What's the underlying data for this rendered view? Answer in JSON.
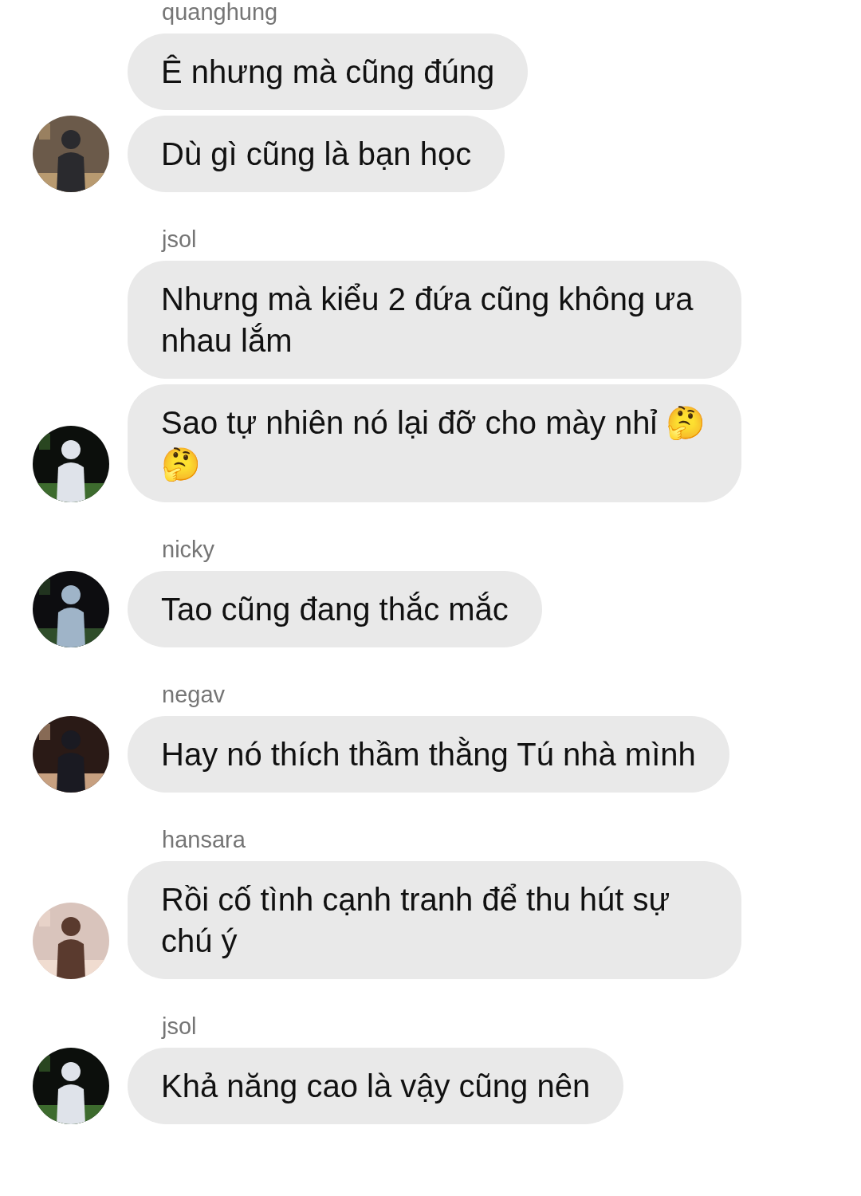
{
  "groups": [
    {
      "sender": "quanghung",
      "avatar": {
        "kind": "picture"
      },
      "messages": [
        "Ê nhưng mà cũng đúng",
        "Dù gì cũng là bạn học"
      ]
    },
    {
      "sender": "jsol",
      "avatar": {
        "kind": "picture"
      },
      "messages": [
        "Nhưng mà kiểu 2 đứa cũng không ưa nhau lắm",
        "Sao tự nhiên nó lại đỡ cho mày nhỉ 🤔🤔"
      ]
    },
    {
      "sender": "nicky",
      "avatar": {
        "kind": "picture"
      },
      "messages": [
        "Tao cũng đang thắc mắc"
      ]
    },
    {
      "sender": "negav",
      "avatar": {
        "kind": "picture"
      },
      "messages": [
        "Hay nó thích thầm thằng Tú nhà mình"
      ]
    },
    {
      "sender": "hansara",
      "avatar": {
        "kind": "picture"
      },
      "messages": [
        "Rồi cố tình cạnh tranh để thu hút sự chú ý"
      ]
    },
    {
      "sender": "jsol",
      "avatar": {
        "kind": "picture"
      },
      "messages": [
        "Khả năng cao là vậy cũng nên"
      ]
    }
  ]
}
